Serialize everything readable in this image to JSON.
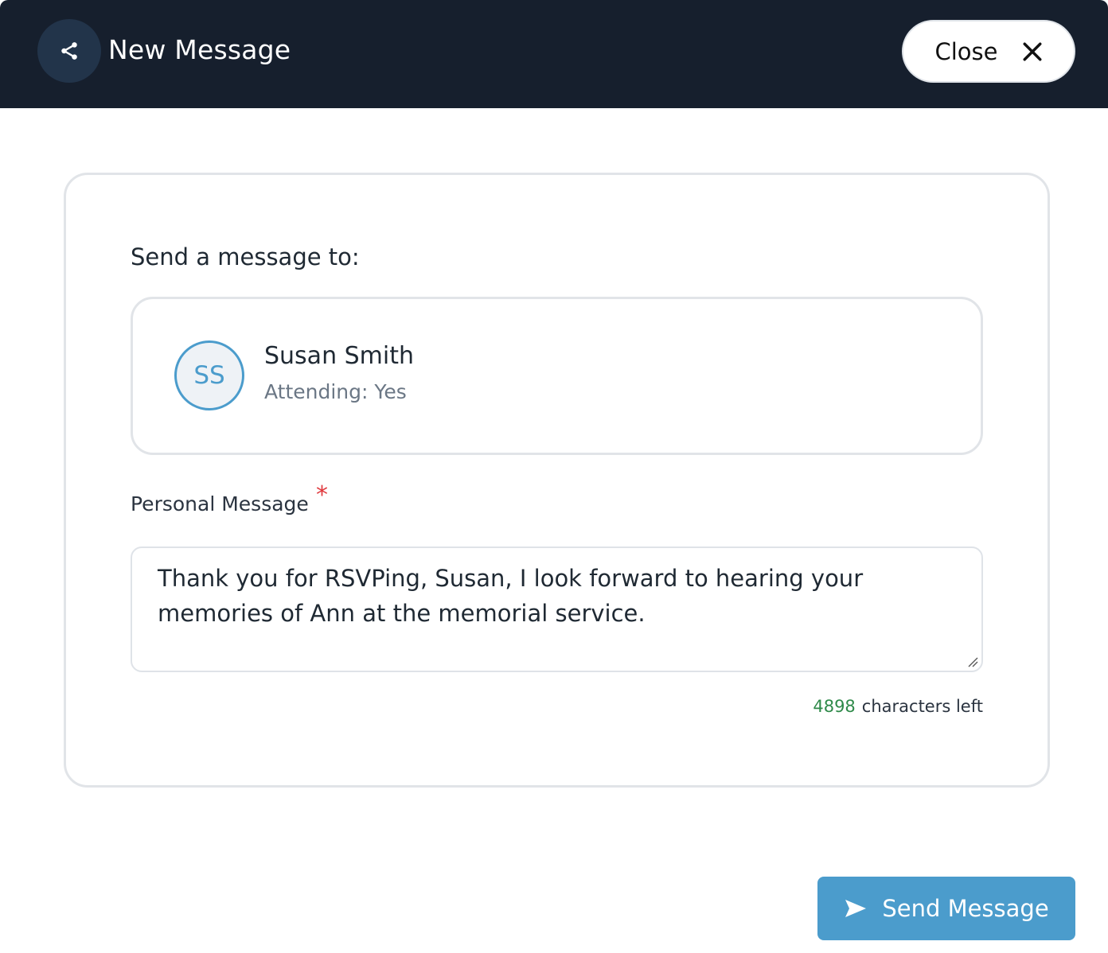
{
  "header": {
    "title": "New Message",
    "close_label": "Close"
  },
  "recipient_section": {
    "label": "Send a message to:",
    "initials": "SS",
    "name": "Susan Smith",
    "status": "Attending: Yes"
  },
  "message": {
    "label": "Personal Message",
    "required_marker": "*",
    "value": "Thank you for RSVPing, Susan, I look forward to hearing your\nmemories of Ann at the memorial service.",
    "chars_left": "4898",
    "chars_left_suffix": "characters left"
  },
  "footer": {
    "send_label": "Send Message"
  },
  "icons": {
    "share": "share-icon",
    "close": "close-icon",
    "send": "send-icon",
    "resize": "resize-handle-icon"
  },
  "colors": {
    "header_bg": "#161f2d",
    "accent": "#4b9ccc",
    "required": "#e0393e",
    "counter": "#2f8a4a"
  }
}
